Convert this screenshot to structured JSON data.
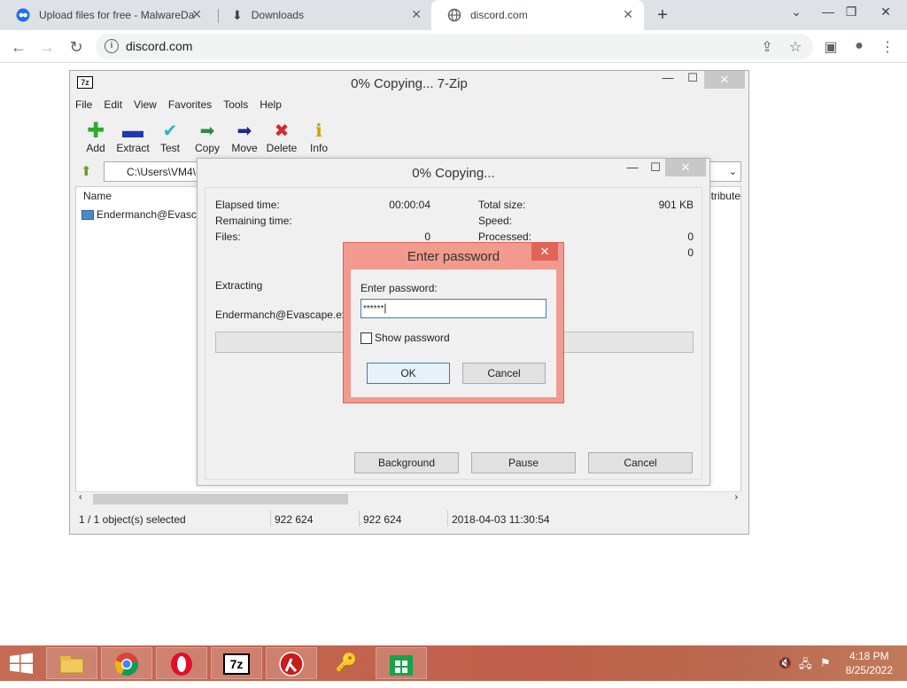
{
  "browser": {
    "tabs": [
      {
        "label": "Upload files for free - MalwareDa",
        "icon": "malwaredata-icon",
        "active": false
      },
      {
        "label": "Downloads",
        "icon": "download-icon",
        "active": false
      },
      {
        "label": "discord.com",
        "icon": "globe-icon",
        "active": true
      }
    ],
    "url": "discord.com"
  },
  "zip_window": {
    "title": "0% Copying... 7-Zip",
    "menu": [
      "File",
      "Edit",
      "View",
      "Favorites",
      "Tools",
      "Help"
    ],
    "toolbar": [
      "Add",
      "Extract",
      "Test",
      "Copy",
      "Move",
      "Delete",
      "Info"
    ],
    "path": "C:\\Users\\VM4\\",
    "columns": {
      "name": "Name",
      "attributes": "tribute"
    },
    "rows": [
      {
        "name": "Endermanch@Evasca"
      }
    ],
    "status": {
      "selected": "1 / 1 object(s) selected",
      "size": "922 624",
      "packed": "922 624",
      "modified": "2018-04-03 11:30:54"
    }
  },
  "copy_dialog": {
    "title": "0% Copying...",
    "elapsed_label": "Elapsed time:",
    "elapsed_value": "00:00:04",
    "remaining_label": "Remaining time:",
    "files_label": "Files:",
    "files_value": "0",
    "total_size_label": "Total size:",
    "total_size_value": "901 KB",
    "speed_label": "Speed:",
    "processed_label": "Processed:",
    "processed_value": "0",
    "extra_value": "0",
    "action": "Extracting",
    "filename": "Endermanch@Evascape.exe",
    "progress": 0,
    "buttons": {
      "background": "Background",
      "pause": "Pause",
      "cancel": "Cancel"
    }
  },
  "password_dialog": {
    "title": "Enter password",
    "prompt": "Enter password:",
    "value": "******",
    "show_password": "Show password",
    "ok": "OK",
    "cancel": "Cancel"
  },
  "taskbar": {
    "apps": [
      "file-explorer-icon",
      "chrome-icon",
      "opera-icon",
      "7zip-icon",
      "lambda-app-icon",
      "keys-app-icon",
      "store-icon"
    ],
    "time": "4:18 PM",
    "date": "8/25/2022"
  }
}
